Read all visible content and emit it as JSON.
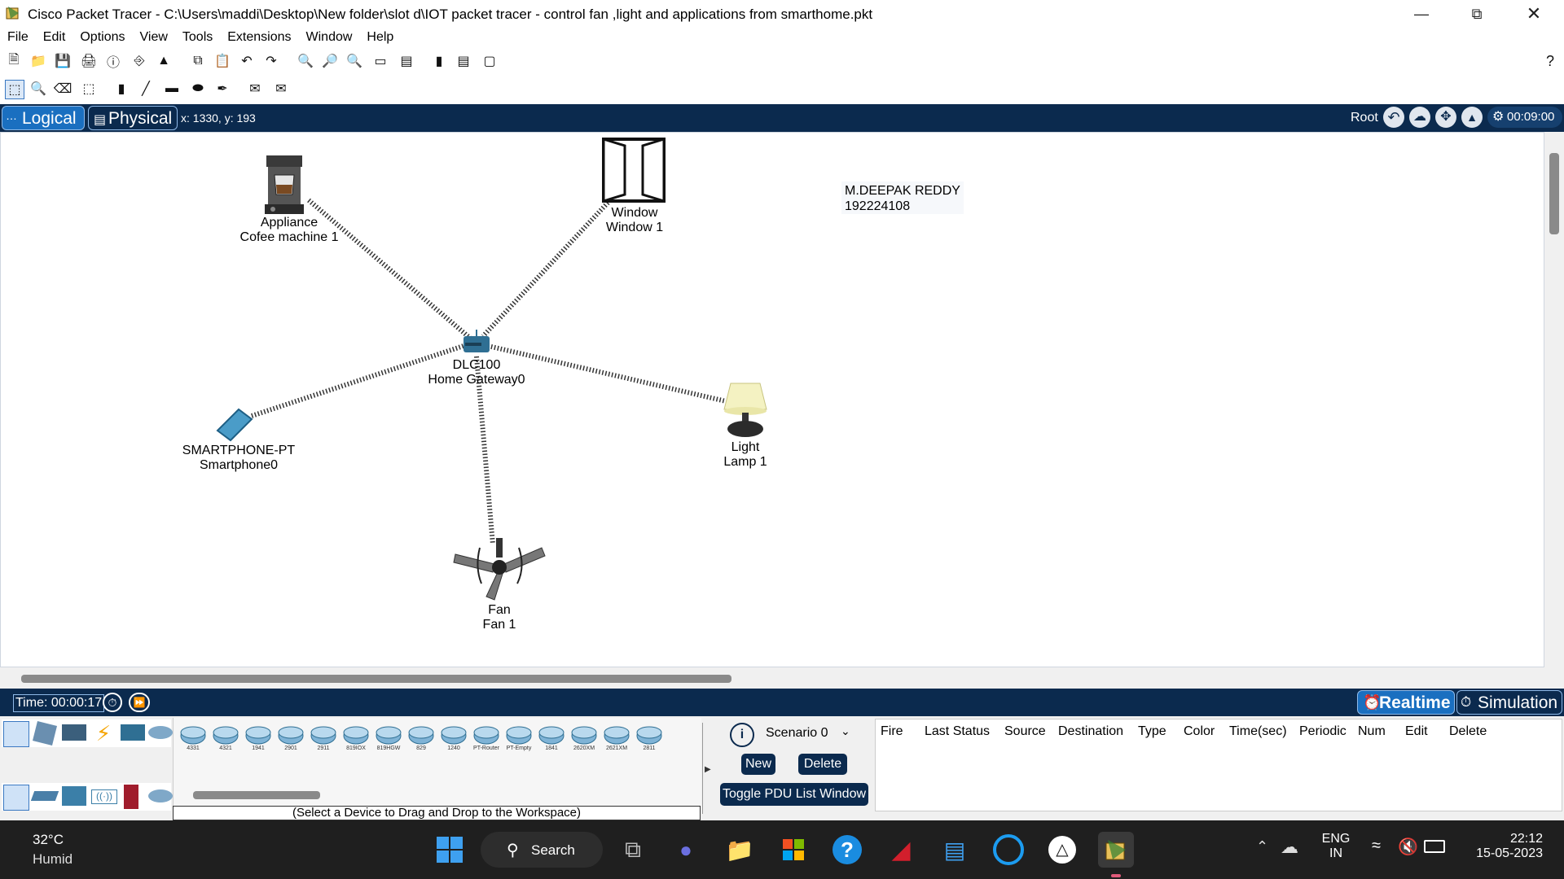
{
  "window": {
    "title": "Cisco Packet Tracer - C:\\Users\\maddi\\Desktop\\New folder\\slot d\\IOT packet tracer - control fan ,light and applications from smarthome.pkt"
  },
  "menu": [
    "File",
    "Edit",
    "Options",
    "View",
    "Tools",
    "Extensions",
    "Window",
    "Help"
  ],
  "help_label": "?",
  "logical_bar": {
    "logical_label": "Logical",
    "physical_label": "Physical",
    "coords": "x: 1330, y: 193",
    "root_label": "Root",
    "time": "00:09:00"
  },
  "workspace": {
    "devices": [
      {
        "id": "appliance",
        "line1": "Appliance",
        "line2": "Cofee machine 1"
      },
      {
        "id": "window",
        "line1": "Window",
        "line2": "Window 1"
      },
      {
        "id": "gateway",
        "line1": "DLC100",
        "line2": "Home Gateway0"
      },
      {
        "id": "smartphone",
        "line1": "SMARTPHONE-PT",
        "line2": "Smartphone0"
      },
      {
        "id": "lamp",
        "line1": "Light",
        "line2": "Lamp 1"
      },
      {
        "id": "fan",
        "line1": "Fan",
        "line2": "Fan 1"
      }
    ],
    "note_line1": "M.DEEPAK REDDY",
    "note_line2": "192224108"
  },
  "timebar": {
    "time": "Time: 00:00:17",
    "realtime": "Realtime",
    "simulation": "Simulation"
  },
  "device_panel": {
    "routers": [
      "4331",
      "4321",
      "1941",
      "2901",
      "2911",
      "819IOX",
      "819HGW",
      "829",
      "1240",
      "PT-Router",
      "PT-Empty",
      "1841",
      "2620XM",
      "2621XM",
      "2811"
    ],
    "hint": "(Select a Device to Drag and Drop to the Workspace)"
  },
  "pdu": {
    "scenario": "Scenario 0",
    "new_label": "New",
    "delete_label": "Delete",
    "toggle_label": "Toggle PDU List Window",
    "columns": [
      "Fire",
      "Last Status",
      "Source",
      "Destination",
      "Type",
      "Color",
      "Time(sec)",
      "Periodic",
      "Num",
      "Edit",
      "Delete"
    ]
  },
  "taskbar": {
    "weather_temp": "32°C",
    "weather_desc": "Humid",
    "search_label": "Search",
    "lang1": "ENG",
    "lang2": "IN",
    "clock_time": "22:12",
    "clock_date": "15-05-2023"
  },
  "colors": {
    "navy": "#0b2a4e",
    "accent": "#1a6fc0",
    "taskbar": "#1f1f1f"
  }
}
